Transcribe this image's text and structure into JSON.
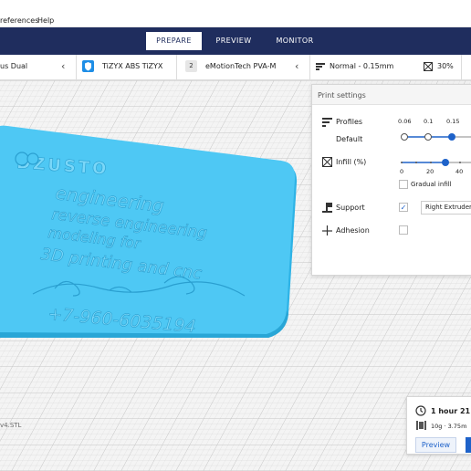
{
  "menu": {
    "preferences": "references",
    "help": "Help"
  },
  "stages": [
    "PREPARE",
    "PREVIEW",
    "MONITOR"
  ],
  "printer": {
    "name": "us Dual"
  },
  "extruders": [
    {
      "badge": "",
      "label": "TiZYX ABS TiZYX"
    },
    {
      "badge": "2",
      "label": "eMotionTech PVA-M"
    }
  ],
  "summary": {
    "profile": "Normal - 0.15mm",
    "infill": "30%"
  },
  "model_text": {
    "logo": "DZUSTO",
    "line1": "engineering",
    "line2": "reverse engineering",
    "line3": "modeling for",
    "line4": "3D printing and cnc",
    "line5": "+7-960-6035194"
  },
  "print_settings": {
    "title": "Print settings",
    "profiles_label": "Profiles",
    "profiles_value": "Default",
    "layer_heights": [
      "0.06",
      "0.1",
      "0.15"
    ],
    "infill_label": "Infill (%)",
    "infill_ticks": [
      "0",
      "20",
      "40"
    ],
    "infill_value": 30,
    "gradual_infill_label": "Gradual infill",
    "support_label": "Support",
    "support_extruder": "Right Extruder",
    "adhesion_label": "Adhesion"
  },
  "estimate": {
    "time": "1 hour 21 mi",
    "material": "10g · 3.75m",
    "preview_label": "Preview"
  },
  "file": {
    "name": "v4.STL"
  },
  "colors": {
    "header": "#1f2d5e",
    "accent": "#1e62c9",
    "model": "#4ec8f4"
  }
}
